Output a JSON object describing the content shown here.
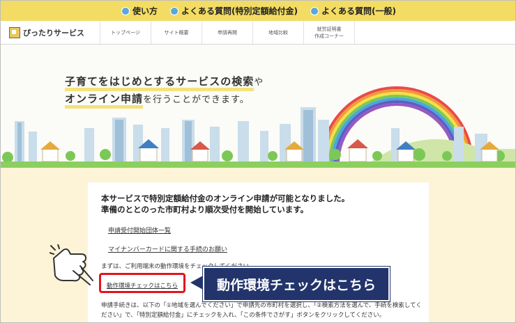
{
  "top_links": [
    {
      "label": "使い方",
      "icon": "info-circle-icon"
    },
    {
      "label": "よくある質問(特別定額給付金)",
      "icon": "question-circle-icon"
    },
    {
      "label": "よくある質問(一般)",
      "icon": "question-circle-icon"
    }
  ],
  "site": {
    "logo_text": "ぴったりサービス"
  },
  "nav": {
    "items": [
      "トップページ",
      "サイト概要",
      "申請再開",
      "地域比較",
      "就労証明書\n作成コーナー"
    ]
  },
  "hero": {
    "line1_highlight": "子育てをはじめとするサービスの検索",
    "line1_tail": "や",
    "line2_highlight": "オンライン申請",
    "line2_tail": "を行うことができます。"
  },
  "notice": {
    "line1": "本サービスで特別定額給付金のオンライン申請が可能となりました。",
    "line2": "準備のととのった市町村より順次受付を開始しています。",
    "link1": "申請受付開始団体一覧",
    "link2": "マイナンバーカードに関する手続のお願い",
    "env_intro": "まずは、ご利用端末の動作環境をチェックしてください。",
    "env_link": "動作環境チェックはこちら",
    "procedure1": "申請手続きは、以下の「①地域を選んでください」で申請先の市町村を選択し、「②検索方法を選んで、手続を検索してく",
    "procedure2": "ださい」で、「特別定額給付金」にチェックを入れ、「この条件でさがす」ボタンをクリックしてください。"
  },
  "callout": {
    "label": "動作環境チェックはこちら"
  },
  "colors": {
    "topbar": "#f2dc63",
    "page_bg": "#fdf3d6",
    "highlight": "#e2141d",
    "callout_bg": "#22346b"
  }
}
